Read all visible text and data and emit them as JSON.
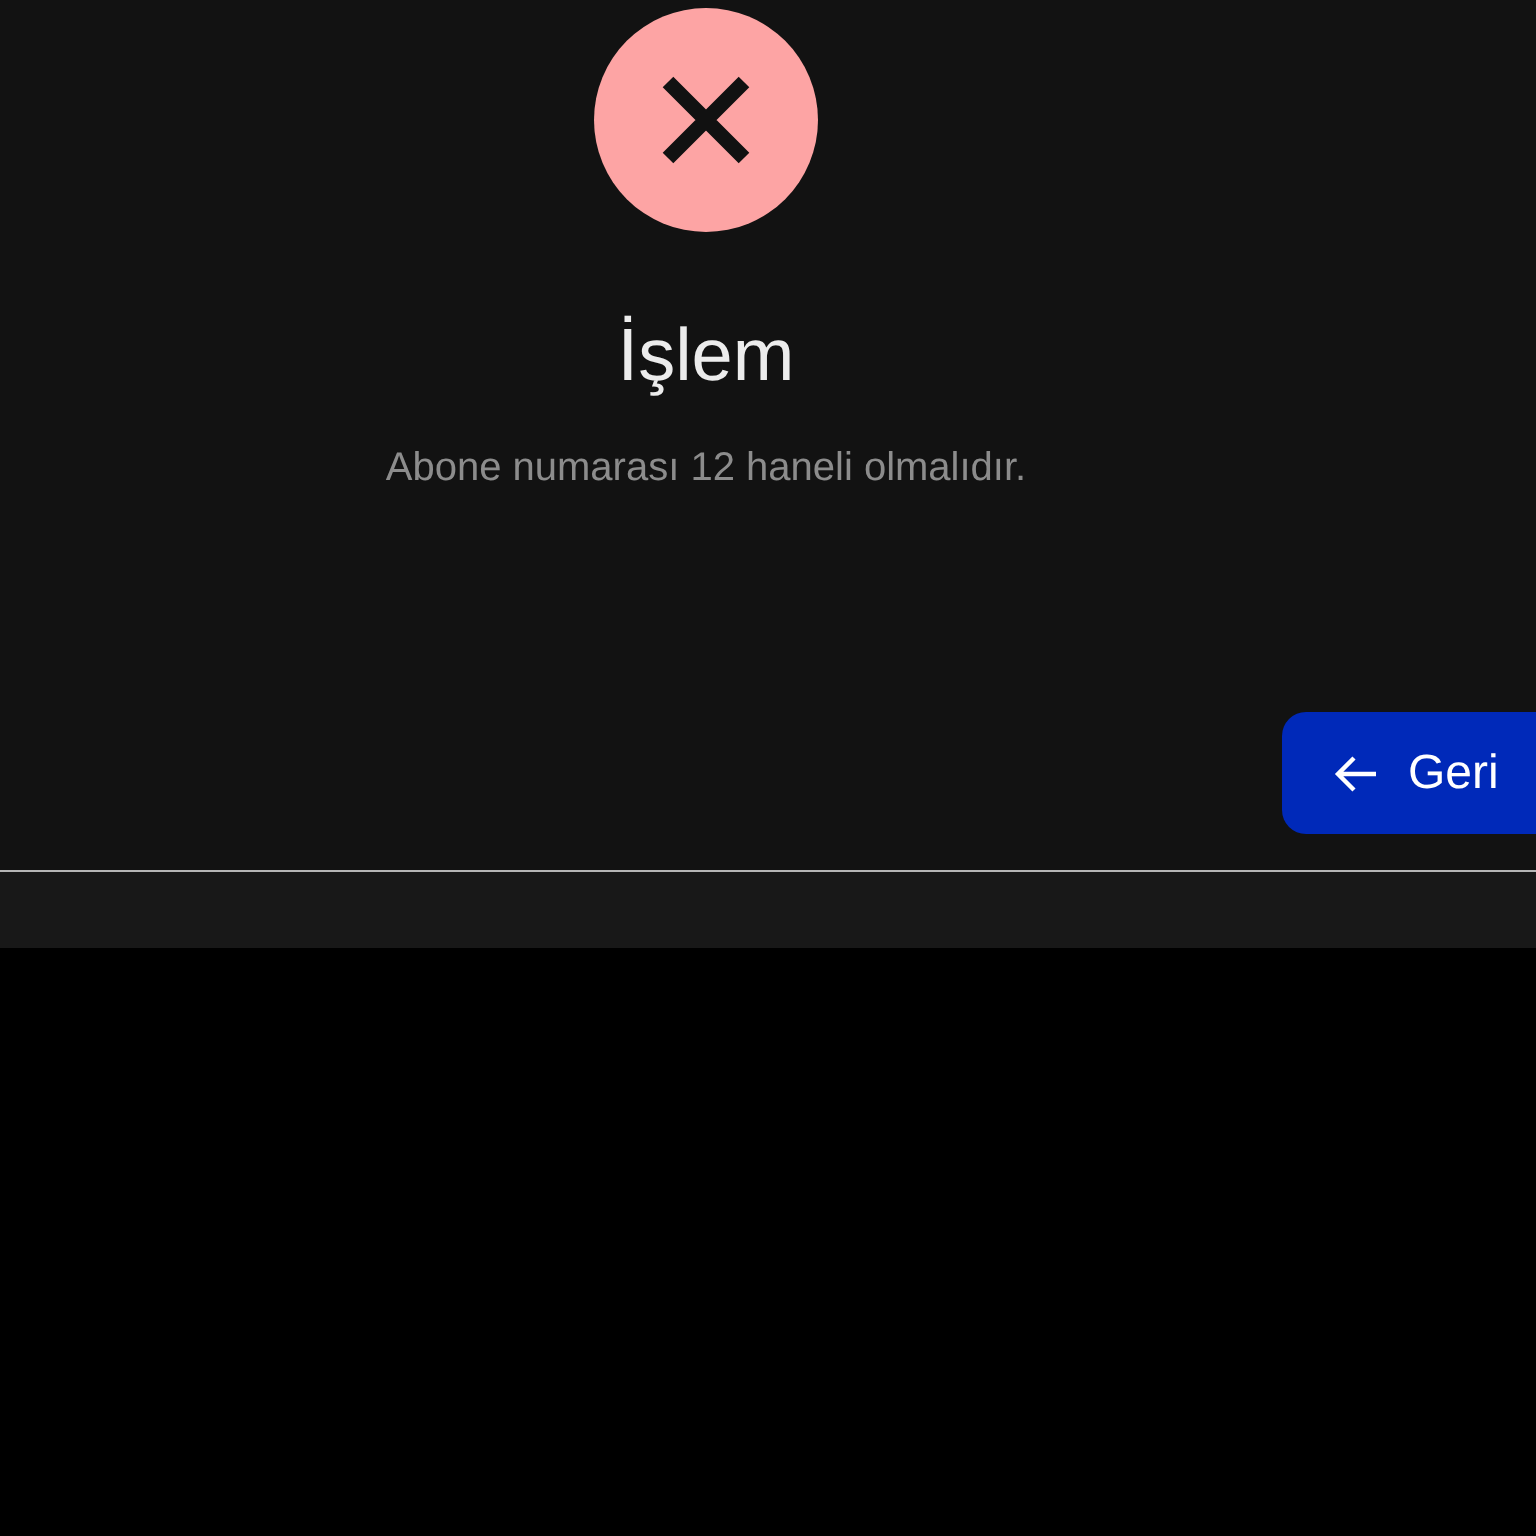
{
  "status_icon": {
    "kind": "error"
  },
  "dialog": {
    "title": "İşlem",
    "message": "Abone numarası 12 haneli olmalıdır."
  },
  "buttons": [
    {
      "label": "Geri",
      "kind": "back"
    }
  ]
}
